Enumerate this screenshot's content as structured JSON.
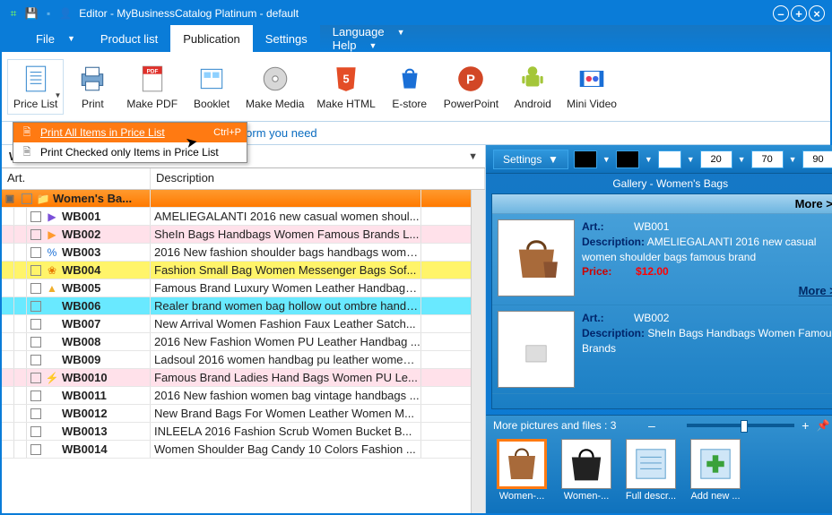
{
  "title": "Editor          - MyBusinessCatalog Platinum - default",
  "menus": {
    "file": "File",
    "product": "Product list",
    "publication": "Publication",
    "settings": "Settings",
    "language": "Language",
    "help": "Help"
  },
  "ribbon": {
    "pricelist": "Price List",
    "print": "Print",
    "makepdf": "Make PDF",
    "booklet": "Booklet",
    "makemedia": "Make Media",
    "makehtml": "Make HTML",
    "estore": "E-store",
    "powerpoint": "PowerPoint",
    "android": "Android",
    "minivideo": "Mini Video"
  },
  "infobar": "Generate and publish the catalog in the form you need",
  "dropdown": {
    "item1": "Print All Items in Price List",
    "sc1": "Ctrl+P",
    "item2": "Print Checked only Items in Price List"
  },
  "breadcrumb": "Women's Handbags",
  "columns": {
    "art": "Art.",
    "desc": "Description"
  },
  "group": "Women's Ba...",
  "rows": [
    {
      "art": "WB001",
      "desc": "AMELIEGALANTI 2016 new casual women shoul...",
      "bg": "#fff",
      "ico": "▶",
      "icoColor": "#7a4fd8"
    },
    {
      "art": "WB002",
      "desc": "SheIn Bags Handbags Women Famous Brands L...",
      "bg": "#ffe1ea",
      "ico": "▶",
      "icoColor": "#ff9a2e"
    },
    {
      "art": "WB003",
      "desc": "2016 New fashion shoulder bags handbags wome...",
      "bg": "#fff",
      "ico": "%",
      "icoColor": "#1a6fd6"
    },
    {
      "art": "WB004",
      "desc": "Fashion Small Bag Women Messenger Bags Sof...",
      "bg": "#fff46a",
      "ico": "❀",
      "icoColor": "#e67a00"
    },
    {
      "art": "WB005",
      "desc": "Famous Brand Luxury Women Leather Handbags...",
      "bg": "#fff",
      "ico": "▲",
      "icoColor": "#efae2a"
    },
    {
      "art": "WB006",
      "desc": "Realer brand women bag hollow out ombre handb...",
      "bg": "#69e9ff",
      "ico": "",
      "icoColor": ""
    },
    {
      "art": "WB007",
      "desc": "New Arrival Women Fashion Faux Leather Satch...",
      "bg": "#fff",
      "ico": "",
      "icoColor": ""
    },
    {
      "art": "WB008",
      "desc": "2016 New Fashion Women PU Leather Handbag ...",
      "bg": "#fff",
      "ico": "",
      "icoColor": ""
    },
    {
      "art": "WB009",
      "desc": "Ladsoul 2016 women handbag pu leather women ...",
      "bg": "#fff",
      "ico": "",
      "icoColor": ""
    },
    {
      "art": "WB0010",
      "desc": "Famous Brand Ladies Hand Bags Women PU Le...",
      "bg": "#ffe1ea",
      "ico": "⚡",
      "icoColor": "#ffb02e"
    },
    {
      "art": "WB0011",
      "desc": "2016 New fashion women bag vintage handbags ...",
      "bg": "#fff",
      "ico": "",
      "icoColor": ""
    },
    {
      "art": "WB0012",
      "desc": "New Brand Bags For Women Leather Women M...",
      "bg": "#fff",
      "ico": "",
      "icoColor": ""
    },
    {
      "art": "WB0013",
      "desc": "INLEELA 2016 Fashion Scrub Women Bucket B...",
      "bg": "#fff",
      "ico": "",
      "icoColor": ""
    },
    {
      "art": "WB0014",
      "desc": "Women Shoulder Bag Candy 10 Colors Fashion ...",
      "bg": "#fff",
      "ico": "",
      "icoColor": ""
    }
  ],
  "right": {
    "settings": "Settings",
    "n1": "20",
    "n2": "70",
    "n3": "90",
    "gallery_title": "Gallery - Women's Bags",
    "more": "More >>",
    "lbl_art": "Art.:",
    "lbl_desc": "Description:",
    "lbl_price": "Price:",
    "items": [
      {
        "art": "WB001",
        "desc": "AMELIEGALANTI 2016 new casual women shoulder bags famous brand",
        "price": "$12.00"
      },
      {
        "art": "WB002",
        "desc": "SheIn Bags Handbags Women Famous Brands"
      }
    ],
    "more2": "More >>"
  },
  "bottom": {
    "title": "More pictures and files :  3",
    "thumbs": [
      "Women-...",
      "Women-...",
      "Full descr...",
      "Add new ..."
    ]
  }
}
